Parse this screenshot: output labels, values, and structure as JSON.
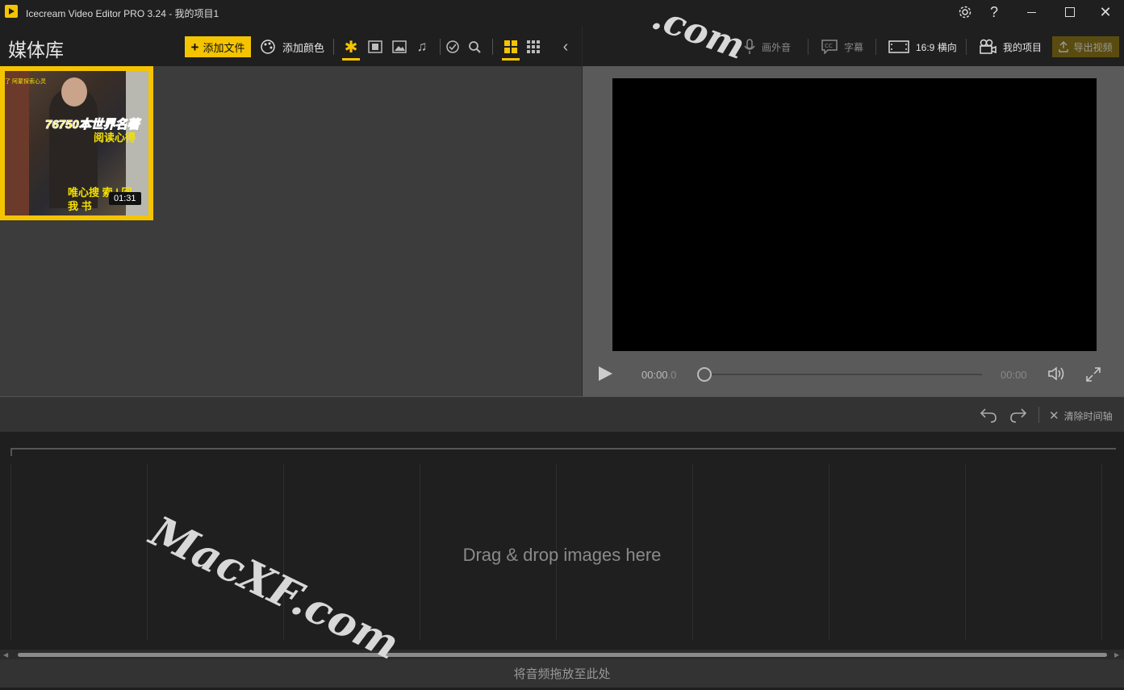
{
  "window": {
    "title": "Icecream Video Editor PRO 3.24  -  我的项目1",
    "controls": [
      "settings-icon",
      "help-icon",
      "minimize-icon",
      "maximize-icon",
      "close-icon"
    ]
  },
  "media": {
    "title": "媒体库",
    "add_file_label": "添加文件",
    "add_color_label": "添加颜色",
    "filters": [
      "star-icon",
      "video-icon",
      "image-icon",
      "music-icon"
    ],
    "active_filter": "star-icon",
    "active_view": "large-grid-icon",
    "thumbnail": {
      "duration": "01:31",
      "caption_top": "了 阿蒙探索心灵",
      "caption_main": "76750本世界名著",
      "caption_sub": "阅读心得",
      "caption_bottom": "唯心搜 索 | 回我 书"
    }
  },
  "preview": {
    "voiceover_label": "画外音",
    "subtitles_label": "字幕",
    "aspect_label": "16:9 横向",
    "project_label": "我的项目",
    "export_label": "导出视频",
    "time_current": "00:00",
    "time_current_ms": ".0",
    "time_end": "00:00"
  },
  "timeline": {
    "clear_label": "清除时间轴",
    "drop_images": "Drag & drop images here",
    "drop_audio": "将音频拖放至此处"
  },
  "watermark": {
    "large": "MacXF.com",
    "top": ".com"
  },
  "colors": {
    "accent": "#f5c400",
    "toolbar_bg": "#1f1f1f",
    "panel_bg": "#3c3c3c"
  }
}
